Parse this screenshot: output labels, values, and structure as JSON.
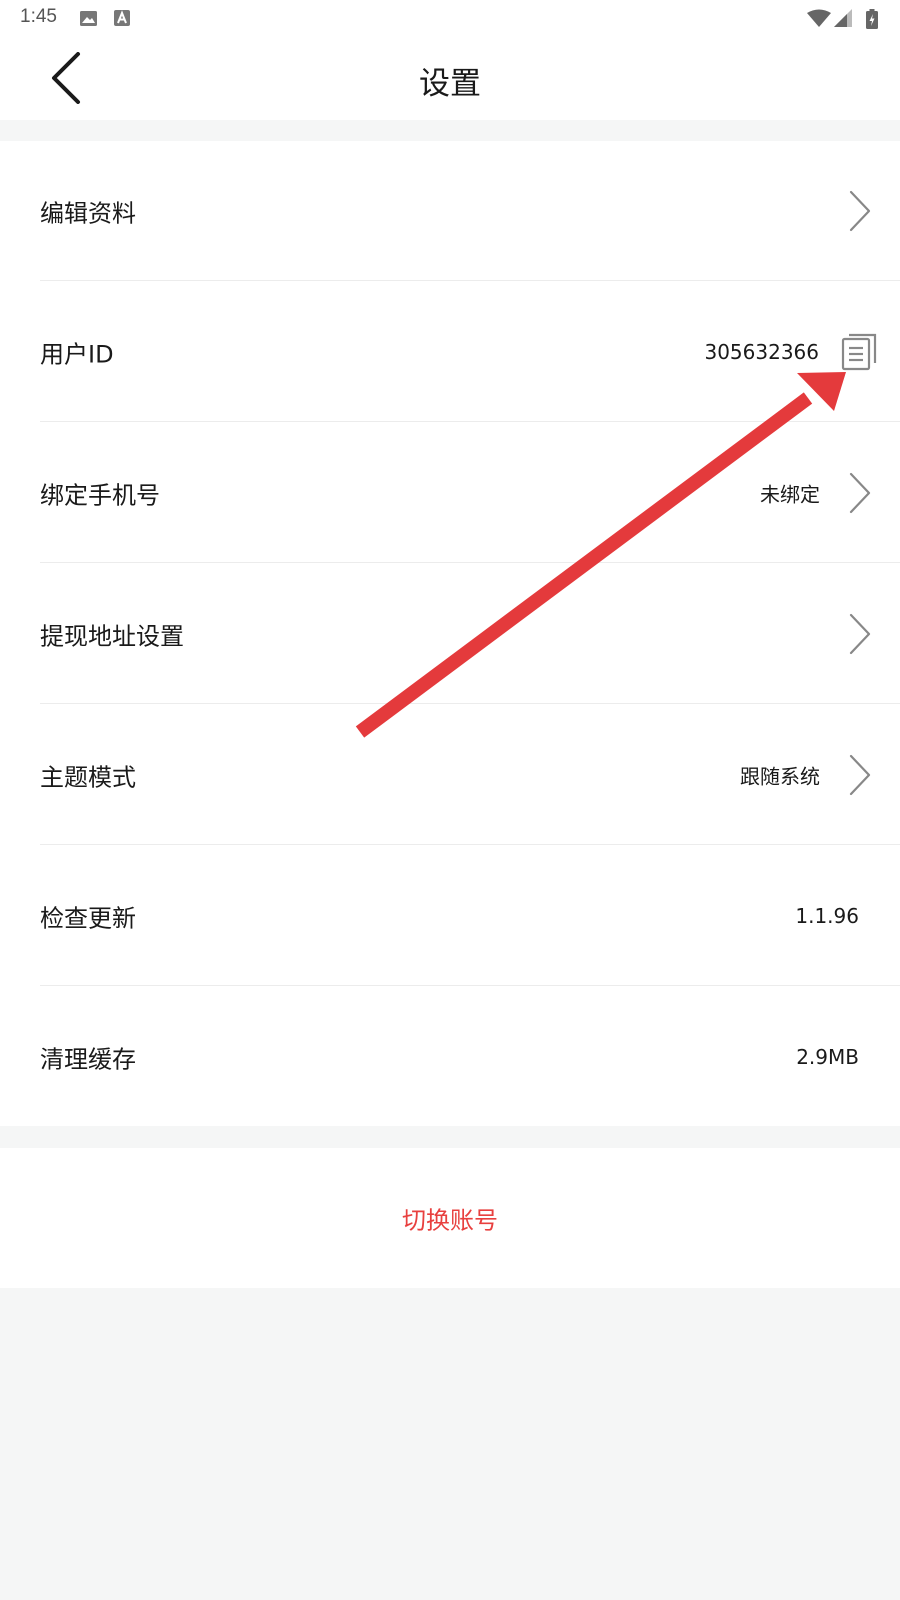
{
  "status_bar": {
    "time": "1:45"
  },
  "header": {
    "title": "设置"
  },
  "settings": {
    "items": [
      {
        "label": "编辑资料",
        "value": ""
      },
      {
        "label": "用户ID",
        "value": "305632366"
      },
      {
        "label": "绑定手机号",
        "value": "未绑定"
      },
      {
        "label": "提现地址设置",
        "value": ""
      },
      {
        "label": "主题模式",
        "value": "跟随系统"
      },
      {
        "label": "检查更新",
        "value": "1.1.96"
      },
      {
        "label": "清理缓存",
        "value": "2.9MB"
      }
    ]
  },
  "footer": {
    "switch_account_label": "切换账号"
  },
  "icons": {
    "back": "back-arrow-icon",
    "chevron": "chevron-right-icon",
    "copy": "copy-icon",
    "annotation": "red-arrow-annotation"
  },
  "colors": {
    "accent_red": "#e8403f",
    "annotation_red": "#e43a3c",
    "background": "#f5f6f6",
    "text": "#1a1a1a"
  }
}
